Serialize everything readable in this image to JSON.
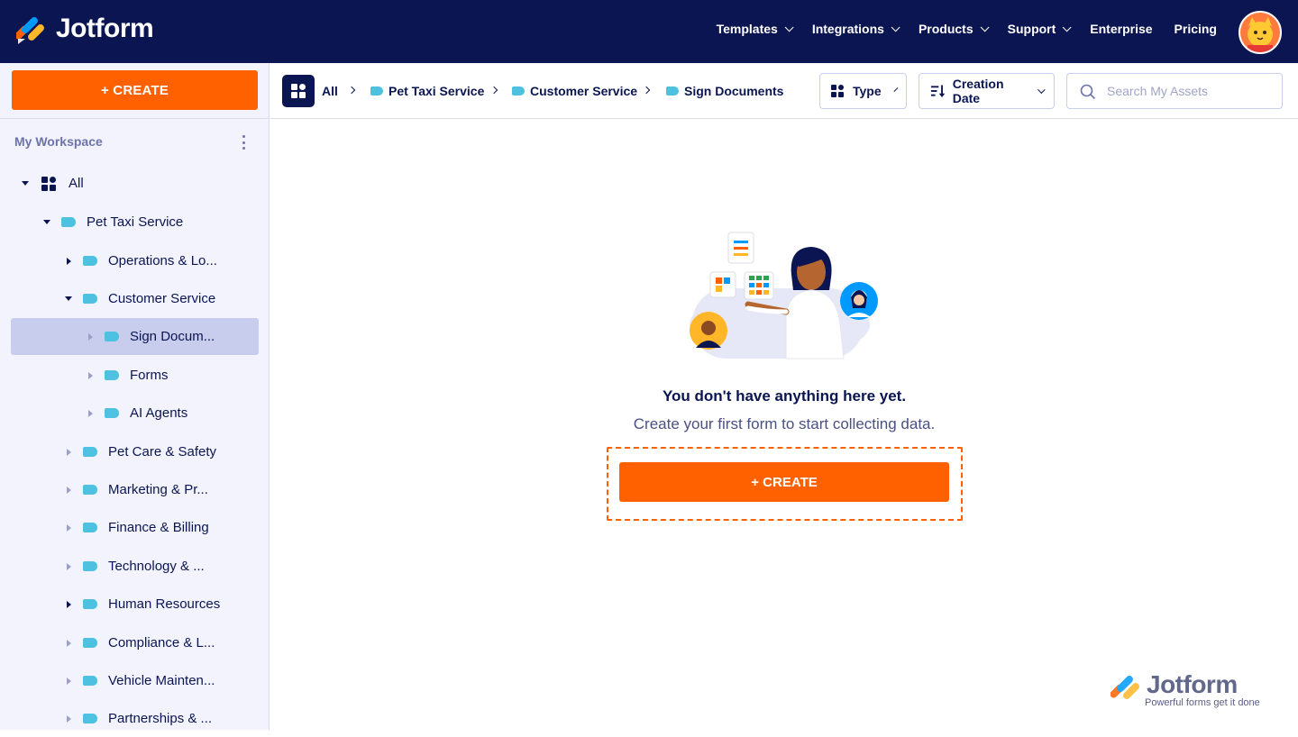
{
  "header": {
    "brand": "Jotform",
    "nav": [
      {
        "label": "Templates",
        "has_menu": true
      },
      {
        "label": "Integrations",
        "has_menu": true
      },
      {
        "label": "Products",
        "has_menu": true
      },
      {
        "label": "Support",
        "has_menu": true
      },
      {
        "label": "Enterprise",
        "has_menu": false
      },
      {
        "label": "Pricing",
        "has_menu": false
      }
    ]
  },
  "sidebar": {
    "create_label": "+ CREATE",
    "workspace_title": "My Workspace",
    "tree": [
      {
        "label": "All",
        "icon": "grid-icon",
        "expanded": true
      },
      {
        "label": "Pet Taxi Service",
        "icon": "folder-icon",
        "expanded": true
      },
      {
        "label": "Operations & Lo...",
        "icon": "folder-icon",
        "expanded": false
      },
      {
        "label": "Customer Service",
        "icon": "folder-icon",
        "expanded": true
      },
      {
        "label": "Sign Docum...",
        "icon": "folder-icon",
        "selected": true
      },
      {
        "label": "Forms",
        "icon": "folder-icon"
      },
      {
        "label": "AI Agents",
        "icon": "folder-icon"
      },
      {
        "label": "Pet Care & Safety",
        "icon": "folder-icon"
      },
      {
        "label": "Marketing & Pr...",
        "icon": "folder-icon"
      },
      {
        "label": "Finance & Billing",
        "icon": "folder-icon"
      },
      {
        "label": "Technology & ...",
        "icon": "folder-icon"
      },
      {
        "label": "Human Resources",
        "icon": "folder-icon"
      },
      {
        "label": "Compliance & L...",
        "icon": "folder-icon"
      },
      {
        "label": "Vehicle Mainten...",
        "icon": "folder-icon"
      },
      {
        "label": "Partnerships & ...",
        "icon": "folder-icon"
      }
    ]
  },
  "toolbar": {
    "breadcrumbs": [
      "All",
      "Pet Taxi Service",
      "Customer Service",
      "Sign Documents"
    ],
    "type_label": "Type",
    "sort_label": "Creation Date",
    "search_placeholder": "Search My Assets"
  },
  "empty_state": {
    "title": "You don't have anything here yet.",
    "subtitle": "Create your first form to start collecting data.",
    "create_label": "+ CREATE"
  },
  "watermark": {
    "brand": "Jotform",
    "tagline": "Powerful forms get it done"
  },
  "colors": {
    "navy": "#0a1551",
    "orange": "#ff6100",
    "folder": "#4fc1e0",
    "selected_bg": "#c8cdee",
    "sidebar_bg": "#f3f3fe"
  }
}
